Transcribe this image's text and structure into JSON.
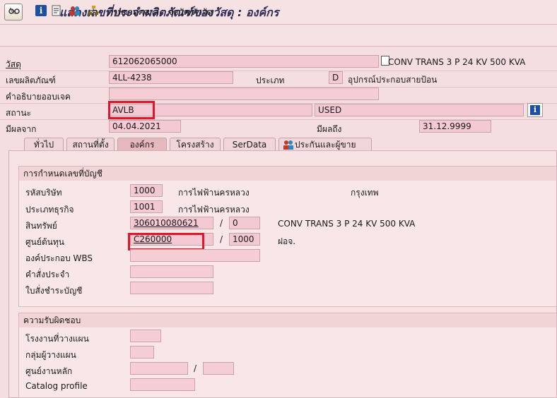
{
  "window": {
    "title": "แสดงเลขที่ประจำผลิตภัณฑ์ของวัสดุ : องค์กร"
  },
  "toolbar": {
    "class_overview_label": "ภาพรวมคลาส",
    "measuring_points_label": "จุดวัด/ตัววัด",
    "icons": [
      "glasses-icon",
      "info-icon",
      "document-icon",
      "people-icon",
      "org-icon"
    ]
  },
  "header": {
    "material_label": "วัสดุ",
    "material_value": "612062065000",
    "material_desc": "CONV TRANS 3 P 24 KV 500 KVA",
    "serial_label": "เลขผลิตภัณฑ์",
    "serial_value": "4LL-4238",
    "type_label": "ประเภท",
    "type_value": "D",
    "type_desc": "อุปกรณ์ประกอบสายป้อน",
    "object_desc_label": "คำอธิบายออบเจค",
    "object_desc_value": "",
    "status_label": "สถานะ",
    "status_value": "AVLB",
    "status_user_value": "USED",
    "valid_from_label": "มีผลจาก",
    "valid_from_value": "04.04.2021",
    "valid_to_label": "มีผลถึง",
    "valid_to_value": "31.12.9999"
  },
  "tabs": [
    {
      "label": "ทั่วไป"
    },
    {
      "label": "สถานที่ตั้ง"
    },
    {
      "label": "องค์กร"
    },
    {
      "label": "โครงสร้าง"
    },
    {
      "label": "SerData"
    },
    {
      "label": "ประกันและผู้ขาย"
    }
  ],
  "active_tab": "องค์กร",
  "account_assignment": {
    "title": "การกำหนดเลขที่บัญชี",
    "company_code_label": "รหัสบริษัท",
    "company_code_value": "1000",
    "company_code_desc": "การไฟฟ้านครหลวง",
    "company_city": "กรุงเทพ",
    "business_area_label": "ประเภทธุรกิจ",
    "business_area_value": "1001",
    "business_area_desc": "การไฟฟ้านครหลวง",
    "asset_label": "สินทรัพย์",
    "asset_value": "306010080621",
    "asset_sub_value": "0",
    "asset_desc": "CONV TRANS 3 P 24 KV 500 KVA",
    "cost_center_label": "ศูนย์ต้นทุน",
    "cost_center_value": "C260000",
    "cost_center_area_value": "1000",
    "cost_center_desc": "ฝอจ.",
    "wbs_label": "องค์ประกอบ WBS",
    "wbs_value": "",
    "standing_order_label": "คำสั่งประจำ",
    "standing_order_value": "",
    "settlement_order_label": "ใบสั่งชำระบัญชี",
    "settlement_order_value": ""
  },
  "responsibilities": {
    "title": "ความรับผิดชอบ",
    "planning_plant_label": "โรงงานที่วางแผน",
    "planning_plant_value": "",
    "planner_group_label": "กลุ่มผู้วางแผน",
    "planner_group_value": "",
    "work_center_label": "ศูนย์งานหลัก",
    "work_center_value": "",
    "work_center_plant_value": "",
    "catalog_profile_label": "Catalog profile",
    "catalog_profile_value": ""
  },
  "colors": {
    "highlight": "#e0162b",
    "field_bg": "#f3c9d3",
    "info_blue": "#1d4fa5"
  }
}
